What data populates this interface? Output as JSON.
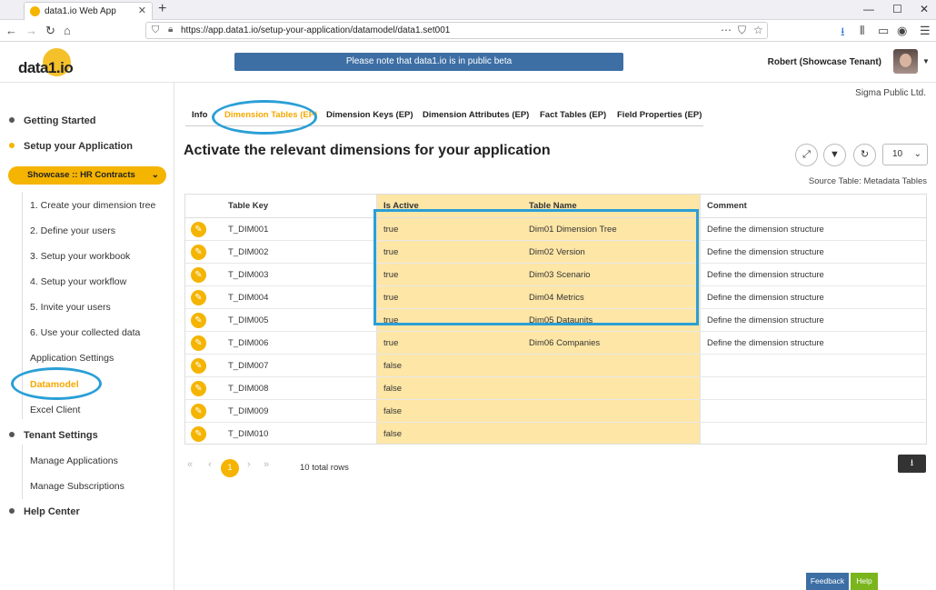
{
  "browser": {
    "tab_title": "data1.io Web App",
    "url": "https://app.data1.io/setup-your-application/datamodel/data1.set001"
  },
  "header": {
    "logo": "data1.io",
    "beta_notice": "Please note that data1.io is in public beta",
    "user": "Robert (Showcase Tenant)"
  },
  "sidebar": {
    "getting_started": "Getting Started",
    "setup_app": "Setup your Application",
    "app_selector": "Showcase :: HR Contracts",
    "setup_items": [
      "1. Create your dimension tree",
      "2. Define your users",
      "3. Setup your workbook",
      "4. Setup your workflow",
      "5. Invite your users",
      "6. Use your collected data",
      "Application Settings",
      "Datamodel",
      "Excel Client"
    ],
    "tenant_settings": "Tenant Settings",
    "tenant_items": [
      "Manage Applications",
      "Manage Subscriptions"
    ],
    "help_center": "Help Center"
  },
  "main": {
    "company": "Sigma Public Ltd.",
    "tabs": [
      "Info",
      "Dimension Tables (EP)",
      "Dimension Keys (EP)",
      "Dimension Attributes (EP)",
      "Fact Tables (EP)",
      "Field Properties (EP)"
    ],
    "heading": "Activate the relevant dimensions for your application",
    "page_size": "10",
    "source": "Source Table: Metadata Tables"
  },
  "table": {
    "columns": [
      "Table Key",
      "Is Active",
      "Table Name",
      "Comment"
    ],
    "rows": [
      {
        "key": "T_DIM001",
        "active": "true",
        "name": "Dim01 Dimension Tree",
        "comment": "Define the dimension structure"
      },
      {
        "key": "T_DIM002",
        "active": "true",
        "name": "Dim02 Version",
        "comment": "Define the dimension structure"
      },
      {
        "key": "T_DIM003",
        "active": "true",
        "name": "Dim03 Scenario",
        "comment": "Define the dimension structure"
      },
      {
        "key": "T_DIM004",
        "active": "true",
        "name": "Dim04 Metrics",
        "comment": "Define the dimension structure"
      },
      {
        "key": "T_DIM005",
        "active": "true",
        "name": "Dim05 Dataunits",
        "comment": "Define the dimension structure"
      },
      {
        "key": "T_DIM006",
        "active": "true",
        "name": "Dim06 Companies",
        "comment": "Define the dimension structure"
      },
      {
        "key": "T_DIM007",
        "active": "false",
        "name": "",
        "comment": ""
      },
      {
        "key": "T_DIM008",
        "active": "false",
        "name": "",
        "comment": ""
      },
      {
        "key": "T_DIM009",
        "active": "false",
        "name": "",
        "comment": ""
      },
      {
        "key": "T_DIM010",
        "active": "false",
        "name": "",
        "comment": ""
      }
    ]
  },
  "footer": {
    "current_page": "1",
    "total_rows": "10 total rows",
    "feedback": "Feedback",
    "help": "Help"
  }
}
